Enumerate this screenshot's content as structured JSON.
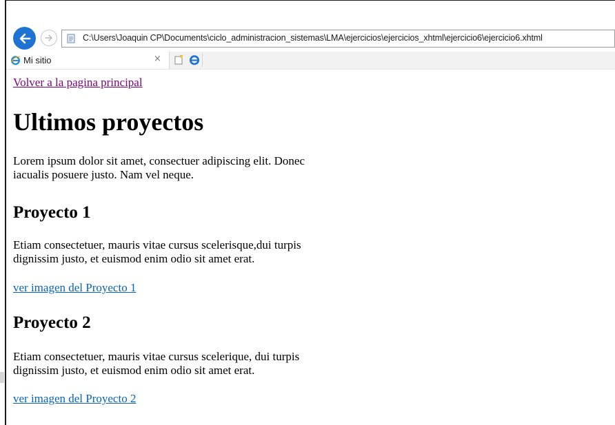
{
  "browser": {
    "address_url": "C:\\Users\\Joaquin CP\\Documents\\ciclo_administracion_sistemas\\LMA\\ejercicios\\ejercicios_xhtml\\ejercicio6\\ejercicio6.xhtml",
    "tab_title": "Mi sitio",
    "tab_close_glyph": "×",
    "icons": [
      "back-arrow-icon",
      "forward-arrow-icon",
      "page-icon",
      "ie-logo-icon",
      "close-icon",
      "new-tab-icon"
    ],
    "accent_color": "#1e73d2"
  },
  "page": {
    "home_link": "Volver a la pagina principal",
    "heading": "Ultimos proyectos",
    "intro": "Lorem ipsum dolor sit amet, consectuer adipiscing elit. Donec iacualis posuere justo. Nam vel neque.",
    "projects": [
      {
        "title": "Proyecto 1",
        "description": "Etiam consectetuer, mauris vitae cursus scelerisque,dui turpis dignissim justo, et euismod enim odio sit amet erat.",
        "link": "ver imagen del Proyecto 1"
      },
      {
        "title": "Proyecto 2",
        "description": "Etiam consectetuer, mauris vitae cursus scelerique, dui turpis dignissim justo, et euismod enim odio sit amet erat.",
        "link": "ver imagen del Proyecto 2"
      }
    ],
    "visited_link_color": "#800080",
    "link_color": "#0563c1"
  }
}
